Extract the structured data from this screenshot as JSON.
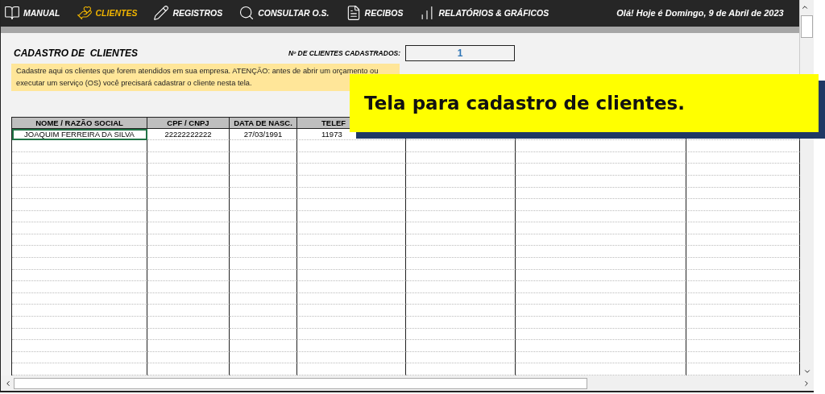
{
  "nav": {
    "items": [
      {
        "label": "MANUAL",
        "selected": false
      },
      {
        "label": "CLIENTES",
        "selected": true
      },
      {
        "label": "REGISTROS",
        "selected": false
      },
      {
        "label": "CONSULTAR O.S.",
        "selected": false
      },
      {
        "label": "RECIBOS",
        "selected": false
      },
      {
        "label": "RELATÓRIOS & GRÁFICOS",
        "selected": false
      }
    ],
    "greeting": "Olá! Hoje é Domingo, 9 de Abril de 2023"
  },
  "page": {
    "title": "CADASTRO DE  CLIENTES",
    "count_label": "Nº DE CLIENTES CADASTRADOS:",
    "count": "1",
    "notice": "Cadastre aqui os clientes que forem atendidos em sua empresa. ATENÇÃO: antes de abrir um orçamento ou executar um serviço (OS) você precisará cadastrar o cliente nesta tela."
  },
  "table": {
    "columns": [
      "NOME / RAZÃO SOCIAL",
      "CPF / CNPJ",
      "DATA DE NASC.",
      "TELEF"
    ],
    "rows": [
      [
        "JOAQUIM FERREIRA DA SILVA",
        "22222222222",
        "27/03/1991",
        "11973"
      ]
    ]
  },
  "callout": {
    "text": "Tela para cadastro de clientes."
  }
}
